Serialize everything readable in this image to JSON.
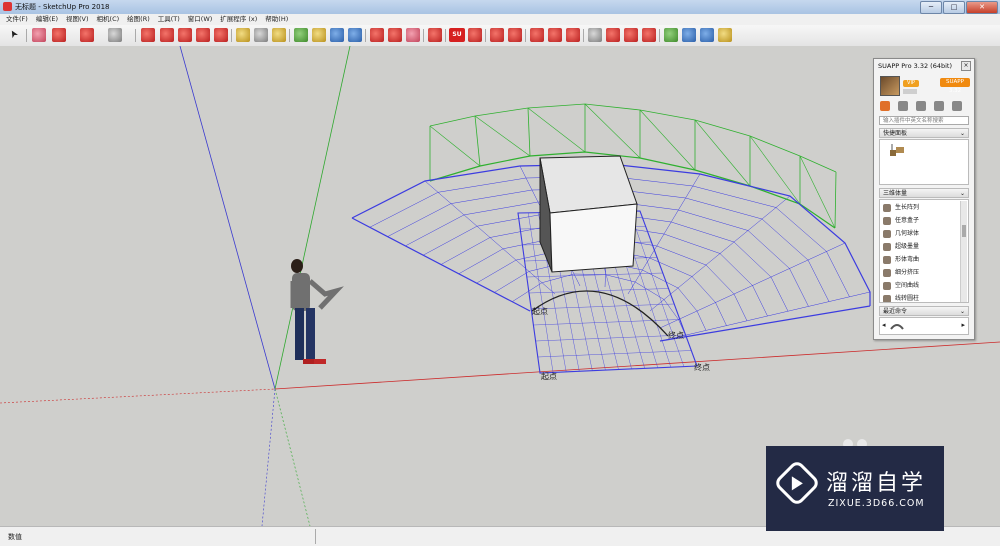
{
  "window": {
    "title": "无标题 - SketchUp Pro 2018",
    "min_label": "─",
    "max_label": "□",
    "close_label": "✕"
  },
  "menu": [
    "文件(F)",
    "编辑(E)",
    "视图(V)",
    "相机(C)",
    "绘图(R)",
    "工具(T)",
    "窗口(W)",
    "扩展程序 (x)",
    "帮助(H)"
  ],
  "toolbar": {
    "su_label": "SU",
    "icons": [
      "select-icon",
      "eraser-icon",
      "pencil-icon",
      "arc-icon",
      "rectangle-icon",
      "push-pull-icon",
      "rotate-icon",
      "move-icon",
      "offset-icon",
      "scale-icon",
      "tape-icon",
      "text-icon",
      "paint-icon",
      "orbit-icon",
      "pan-icon",
      "zoom-icon",
      "zoom-extents-icon",
      "warehouse-icon",
      "extension-icon",
      "component-icon",
      "ruby-icon",
      "suapp-icon",
      "box-icon",
      "solid-union-icon",
      "solid-subtract-icon",
      "section-icon",
      "section-cut-icon",
      "style-icon",
      "shadow-icon",
      "fog-icon",
      "axes-icon",
      "axes-2-icon",
      "axes-3-icon",
      "layer-icon"
    ]
  },
  "viewport": {
    "labels": {
      "start": "起点",
      "mid": "起点",
      "arc_end": "终点",
      "end": "终点"
    },
    "colors": {
      "background": "#cfcfcc",
      "axis_red": "#cc2b2b",
      "axis_green": "#2ea82e",
      "axis_blue": "#3a3acf",
      "grid_blue": "#3c3ce0",
      "frame_green": "#2fb02f"
    }
  },
  "status": {
    "label": "数值"
  },
  "panel": {
    "title": "SUAPP Pro 3.32 (64bit)",
    "close_label": "×",
    "vip_label": "VIP",
    "suapp_badge": "SUAPP 3.32",
    "search_placeholder": "输入插件中英文名称搜索",
    "section_quick": "快捷面板",
    "section_3d": "三维体量",
    "section_recent": "最近命令",
    "items": [
      "生长阵列",
      "任意盒子",
      "几何球体",
      "超级墨量",
      "形体弯曲",
      "细分挤压",
      "空间曲线",
      "线转圆柱"
    ]
  },
  "watermark": {
    "brand_cn": "溜溜自学",
    "brand_en": "ZIXUE.3D66.COM"
  }
}
